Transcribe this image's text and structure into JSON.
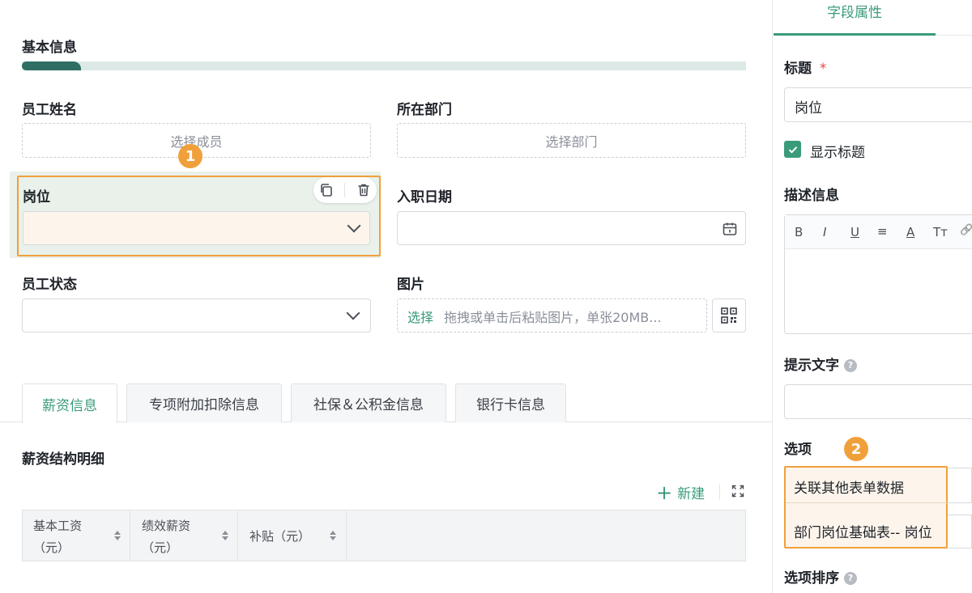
{
  "form": {
    "section_title": "基本信息",
    "fields": {
      "employee_name": {
        "label": "员工姓名",
        "placeholder": "选择成员"
      },
      "department": {
        "label": "所在部门",
        "placeholder": "选择部门"
      },
      "position": {
        "label": "岗位"
      },
      "hire_date": {
        "label": "入职日期"
      },
      "employee_status": {
        "label": "员工状态"
      },
      "image": {
        "label": "图片",
        "select_link": "选择",
        "hint": "拖拽或单击后粘贴图片，单张20MB..."
      }
    },
    "markers": {
      "m1": "1",
      "m2": "2"
    }
  },
  "tabs": [
    {
      "label": "薪资信息",
      "active": true
    },
    {
      "label": "专项附加扣除信息",
      "active": false
    },
    {
      "label": "社保＆公积金信息",
      "active": false
    },
    {
      "label": "银行卡信息",
      "active": false
    }
  ],
  "subtable": {
    "title": "薪资结构明细",
    "new_button": "新建",
    "columns": [
      {
        "line1": "基本工资",
        "line2": "（元）"
      },
      {
        "line1": "绩效薪资",
        "line2": "（元）"
      },
      {
        "line1": "补贴（元）",
        "line2": ""
      }
    ]
  },
  "panel": {
    "tab": "字段属性",
    "title_label": "标题",
    "required_star": "*",
    "title_value": "岗位",
    "show_title": "显示标题",
    "description_label": "描述信息",
    "toolbar": [
      "B",
      "I",
      "U",
      "≡",
      "A",
      "Tт",
      "🔗"
    ],
    "hint_label": "提示文字",
    "help_glyph": "?",
    "options_label": "选项",
    "option_source": "关联其他表单数据",
    "option_value": "部门岗位基础表-- 岗位",
    "sort_label": "选项排序"
  },
  "colors": {
    "accent": "#3a9b7a",
    "highlight": "#f0a03a",
    "selected_bg": "#e9f1ea"
  }
}
